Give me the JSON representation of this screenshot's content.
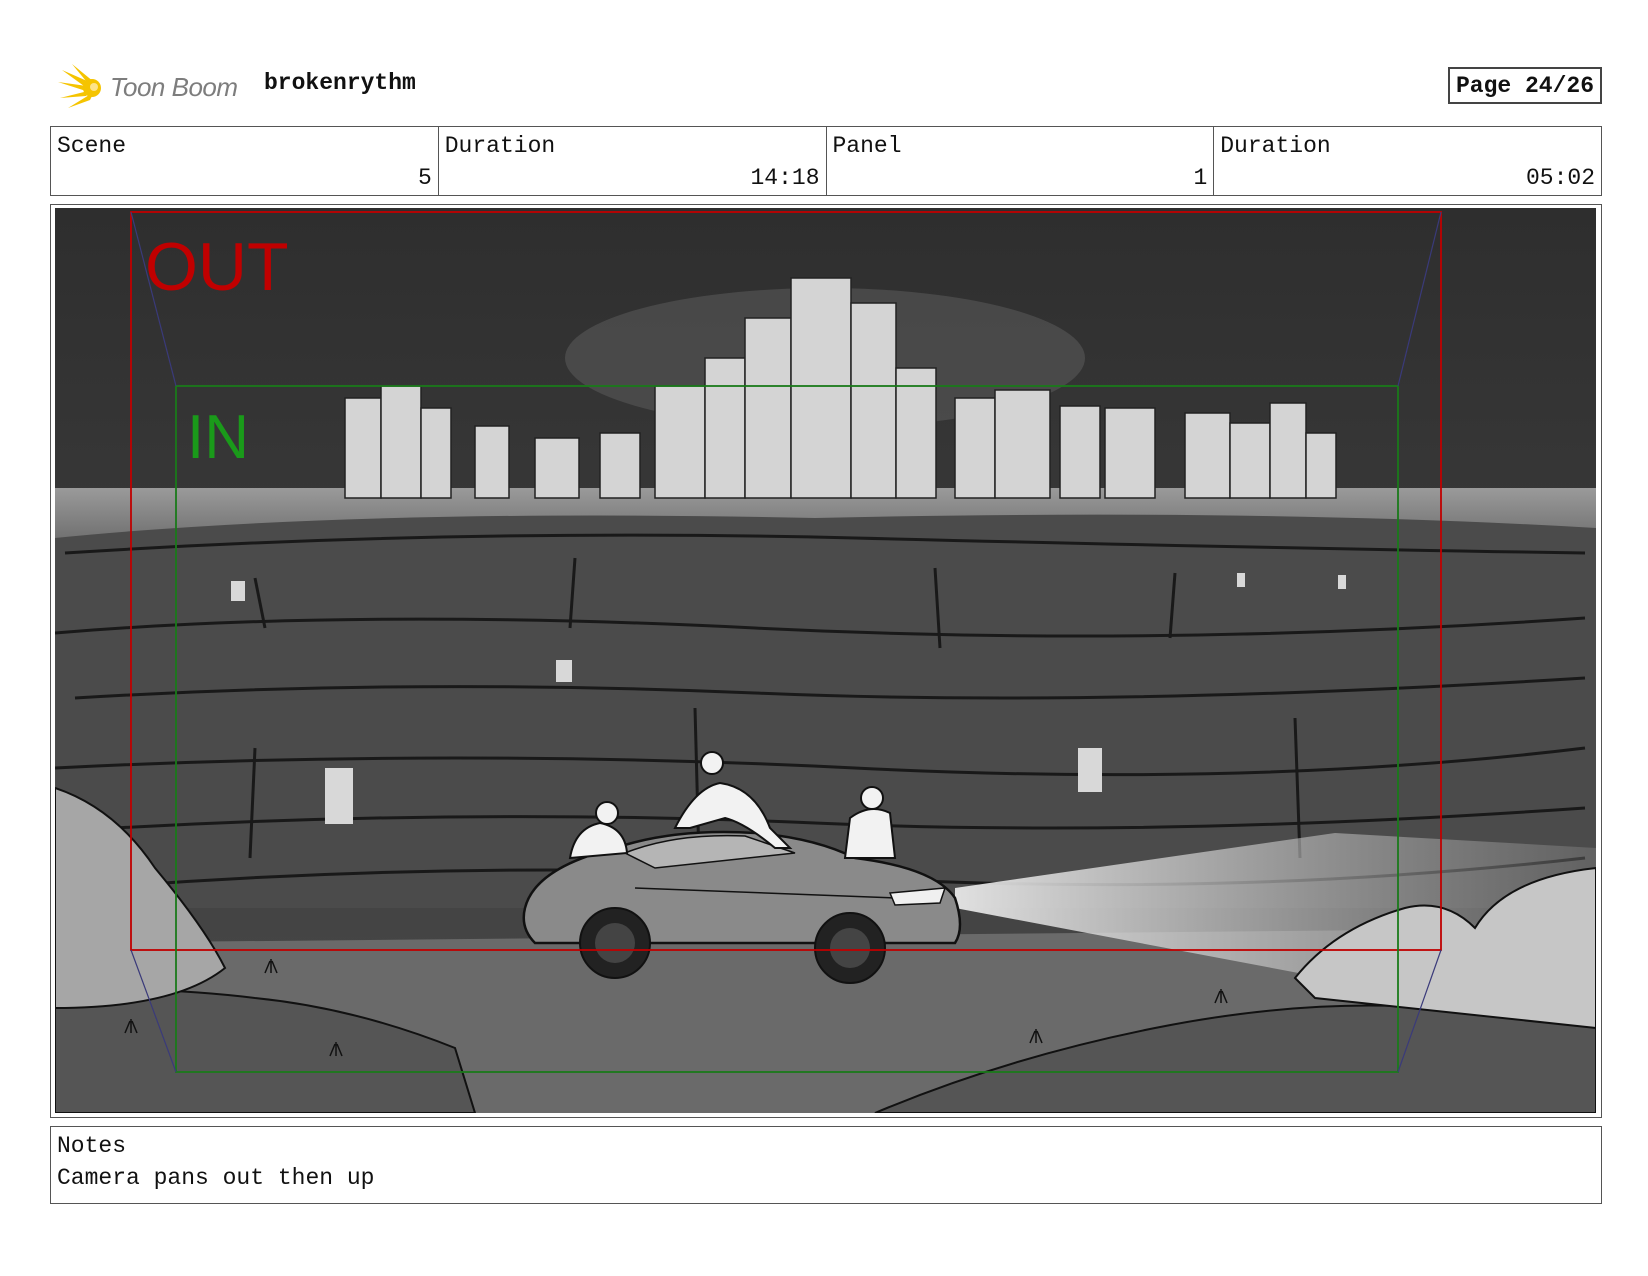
{
  "header": {
    "logo_text": "Toon Boom",
    "logo_icon": "toon-boom-burst-icon",
    "project_name": "brokenrythm",
    "page_label": "Page 24/26"
  },
  "info": {
    "scene_label": "Scene",
    "scene_value": "5",
    "scene_duration_label": "Duration",
    "scene_duration_value": "14:18",
    "panel_label": "Panel",
    "panel_value": "1",
    "panel_duration_label": "Duration",
    "panel_duration_value": "05:02"
  },
  "panel": {
    "out_label": "OUT",
    "in_label": "IN",
    "out_color": "#c00000",
    "in_color": "#1a9a1a"
  },
  "notes": {
    "label": "Notes",
    "text": "Camera pans out then up"
  },
  "colors": {
    "logo_yellow": "#f5c400",
    "logo_gray": "#7d7d7d",
    "border": "#555555"
  }
}
